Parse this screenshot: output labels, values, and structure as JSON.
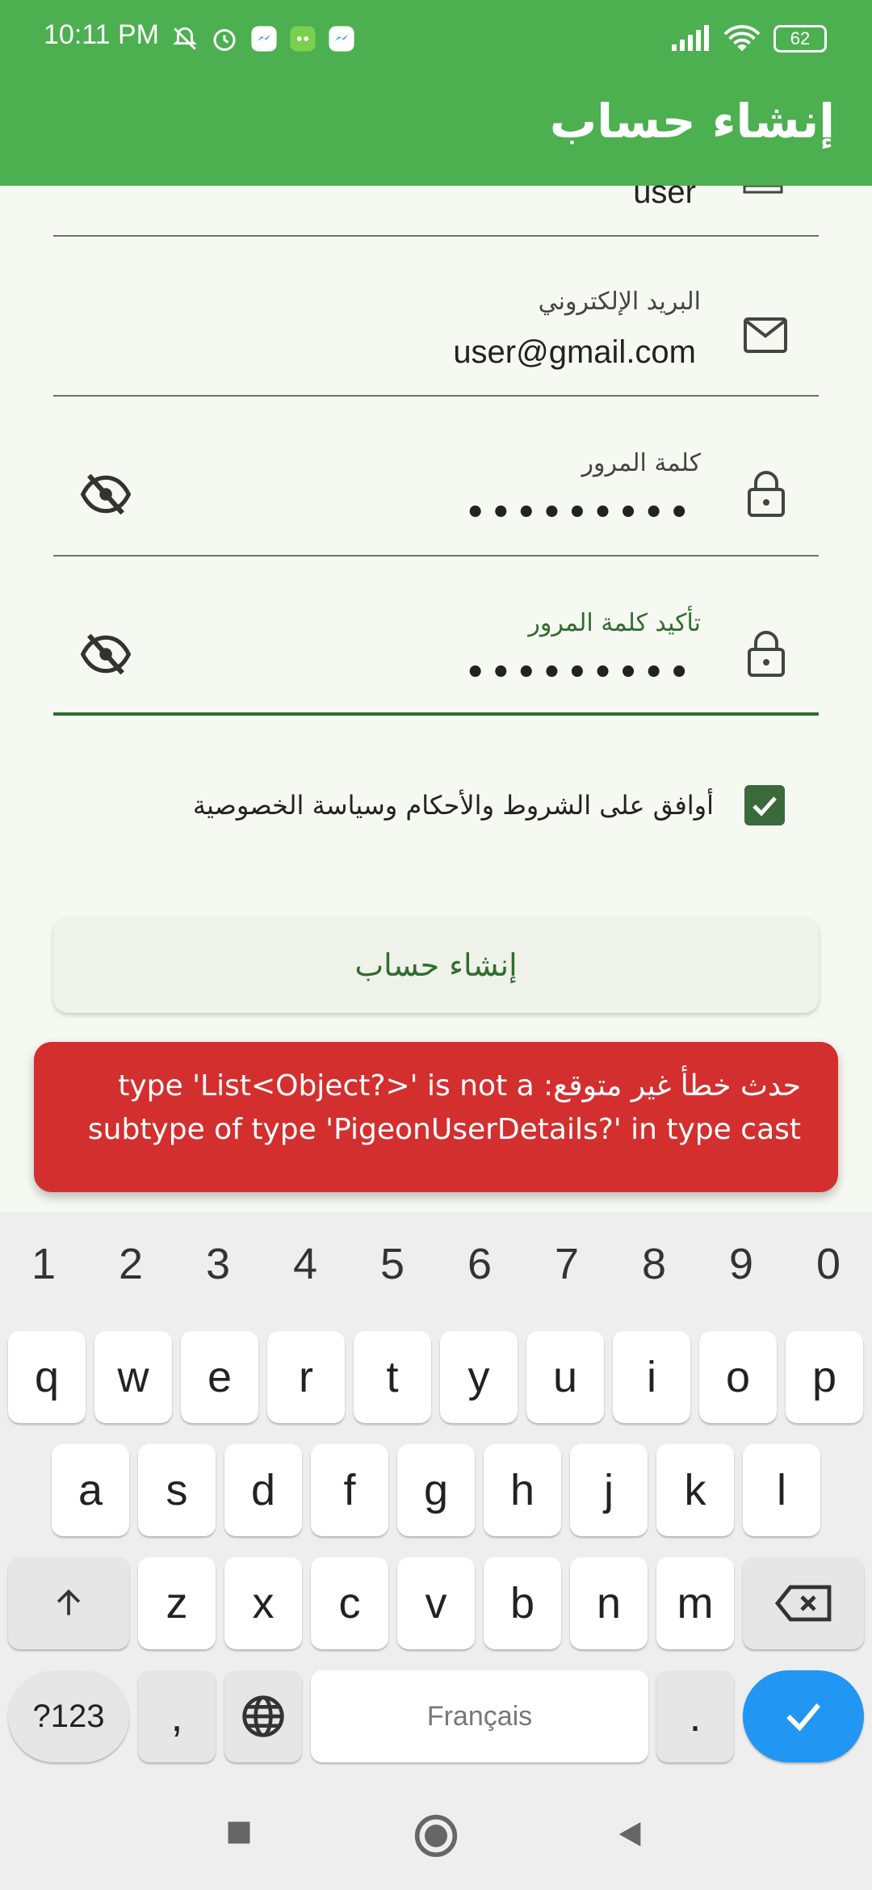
{
  "status_bar": {
    "time": "10:11 PM",
    "battery": "62"
  },
  "app_bar": {
    "title": "إنشاء حساب"
  },
  "form": {
    "username_value": "user",
    "email_label": "البريد الإلكتروني",
    "email_value": "user@gmail.com",
    "password_label": "كلمة المرور",
    "password_value": "•••••••••",
    "confirm_label": "تأكيد كلمة المرور",
    "confirm_value": "•••••••••",
    "agree_text": "أوافق على الشروط والأحكام وسياسة الخصوصية",
    "create_button": "إنشاء حساب"
  },
  "error": {
    "message_line1": "حدث خطأ غير متوقع: type 'List<Object?>' is not a",
    "message_line2": "subtype of type 'PigeonUserDetails?' in type cast"
  },
  "keyboard": {
    "numbers": [
      "1",
      "2",
      "3",
      "4",
      "5",
      "6",
      "7",
      "8",
      "9",
      "0"
    ],
    "row1": [
      "q",
      "w",
      "e",
      "r",
      "t",
      "y",
      "u",
      "i",
      "o",
      "p"
    ],
    "row2": [
      "a",
      "s",
      "d",
      "f",
      "g",
      "h",
      "j",
      "k",
      "l"
    ],
    "row3": [
      "z",
      "x",
      "c",
      "v",
      "b",
      "n",
      "m"
    ],
    "sym_label": "?123",
    "comma": ",",
    "space_label": "Français",
    "period": "."
  },
  "colors": {
    "accent": "#4caf50",
    "error": "#d32f2f",
    "check": "#3b6a3a",
    "enter_key": "#2196f3"
  },
  "icons": {
    "email": "mail-icon",
    "password": "lock-icon",
    "visibility": "eye-off-icon",
    "check": "checkbox-checked-icon"
  }
}
